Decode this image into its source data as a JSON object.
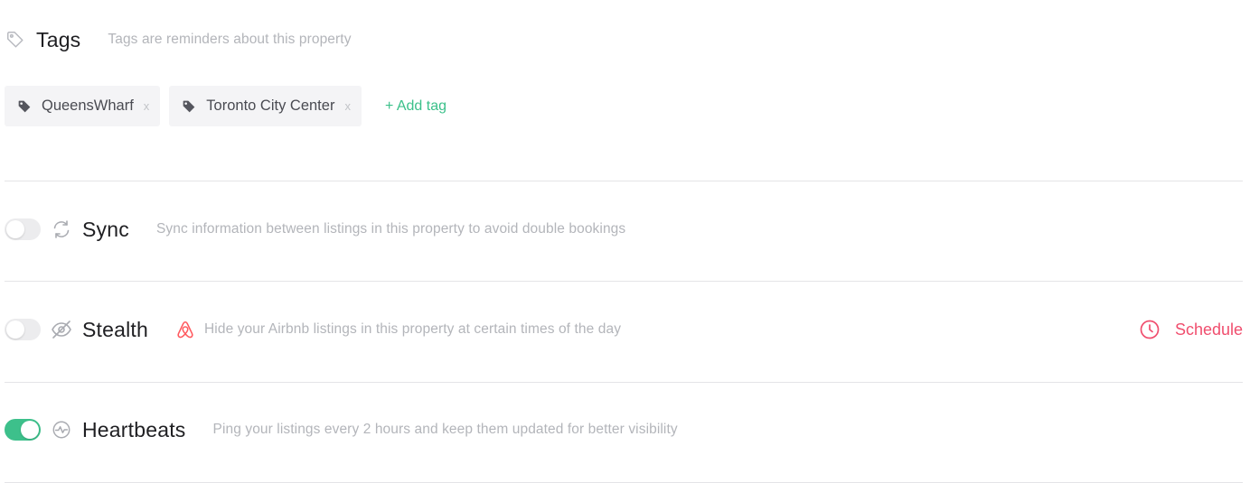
{
  "colors": {
    "accent_green": "#3bc08a",
    "schedule_pink": "#f04e6e",
    "airbnb_red": "#ff5a5f",
    "muted_text": "#b3b5ba",
    "title_text": "#1f1f22"
  },
  "tags_section": {
    "icon": "tag-outline-icon",
    "title": "Tags",
    "description": "Tags are reminders about this property",
    "tags": [
      {
        "label": "QueensWharf",
        "remove": "x",
        "icon": "tag-icon"
      },
      {
        "label": "Toronto City Center",
        "remove": "x",
        "icon": "tag-icon"
      }
    ],
    "add_tag_label": "+ Add tag"
  },
  "features": {
    "sync": {
      "enabled": false,
      "icon": "sync-icon",
      "title": "Sync",
      "description": "Sync information between listings in this property to avoid double bookings"
    },
    "stealth": {
      "enabled": false,
      "icon": "eye-slash-icon",
      "platform_icon": "airbnb-icon",
      "title": "Stealth",
      "description": "Hide your Airbnb listings in this property at certain times of the day",
      "schedule_label": "Schedule",
      "schedule_icon": "clock-icon"
    },
    "heartbeats": {
      "enabled": true,
      "icon": "heartbeat-icon",
      "title": "Heartbeats",
      "description": "Ping your listings every 2 hours and keep them updated for better visibility"
    }
  }
}
